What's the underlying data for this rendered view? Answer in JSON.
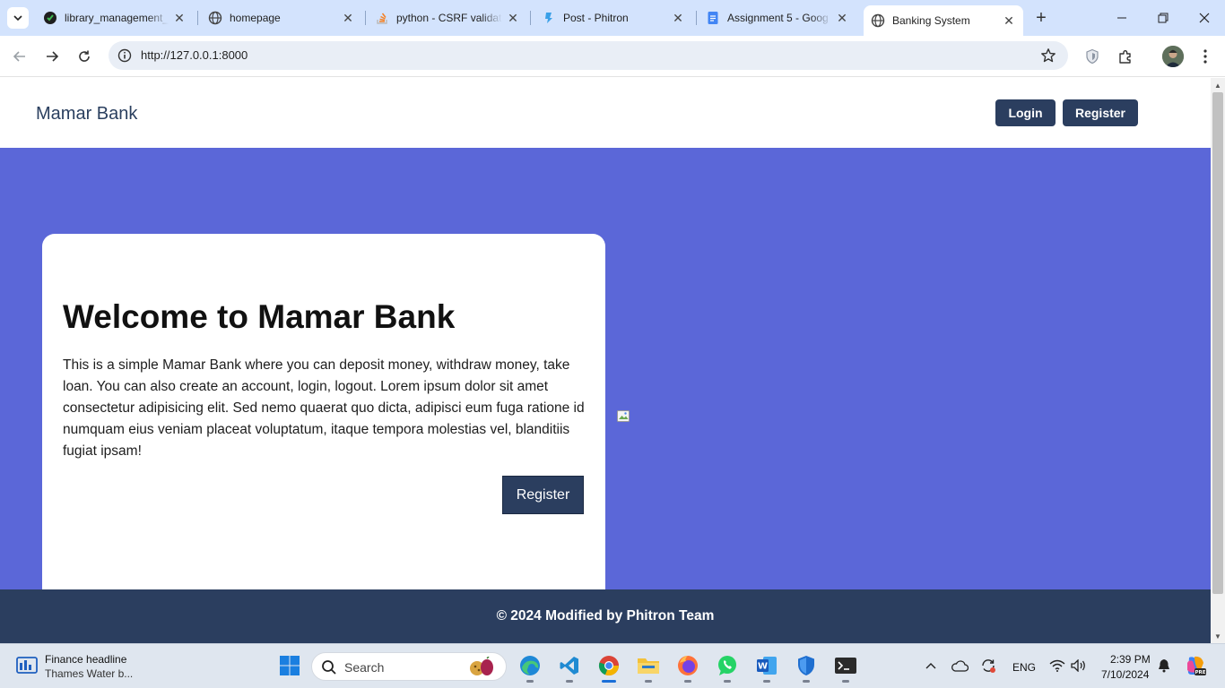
{
  "browser": {
    "tabs": [
      {
        "title": "library_management_",
        "icon": "github-icon",
        "active": false
      },
      {
        "title": "homepage",
        "icon": "globe-icon",
        "active": false
      },
      {
        "title": "python - CSRF validat",
        "icon": "stackoverflow-icon",
        "active": false
      },
      {
        "title": "Post - Phitron",
        "icon": "phitron-icon",
        "active": false
      },
      {
        "title": "Assignment 5 - Goog",
        "icon": "google-docs-icon",
        "active": false
      },
      {
        "title": "Banking System",
        "icon": "globe-icon",
        "active": true
      }
    ],
    "url": "http://127.0.0.1:8000"
  },
  "site": {
    "brand": "Mamar Bank",
    "nav": {
      "login": "Login",
      "register": "Register"
    },
    "hero": {
      "title": "Welcome to Mamar Bank",
      "text": "This is a simple Mamar Bank where you can deposit money, withdraw money, take loan. You can also create an account, login, logout. Lorem ipsum dolor sit amet consectetur adipisicing elit. Sed nemo quaerat quo dicta, adipisci eum fuga ratione id numquam eius veniam placeat voluptatum, itaque tempora molestias vel, blanditiis fugiat ipsam!",
      "button": "Register"
    },
    "footer": "© 2024 Modified by Phitron Team",
    "colors": {
      "primary": "#2b3e5f",
      "hero_bg": "#5b67d8",
      "card_bg": "#ffffff"
    }
  },
  "taskbar": {
    "news_headline": "Finance headline",
    "news_sub": "Thames Water b...",
    "search_placeholder": "Search",
    "language": "ENG",
    "time": "2:39 PM",
    "date": "7/10/2024"
  }
}
